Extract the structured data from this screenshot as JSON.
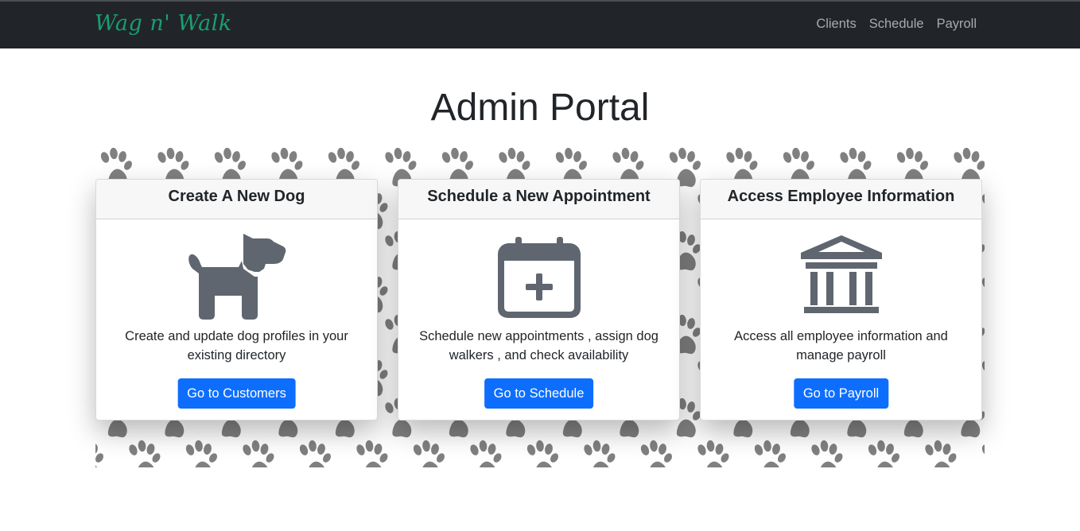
{
  "navbar": {
    "brand": "Wag n' Walk",
    "links": [
      "Clients",
      "Schedule",
      "Payroll"
    ]
  },
  "page": {
    "title": "Admin Portal"
  },
  "cards": [
    {
      "header": "Create A New Dog",
      "icon": "dog-icon",
      "text": "Create and update dog profiles in your existing directory",
      "button": "Go to Customers"
    },
    {
      "header": "Schedule a New Appointment",
      "icon": "calendar-plus-icon",
      "text": "Schedule new appointments , assign dog walkers , and check availability",
      "button": "Go to Schedule"
    },
    {
      "header": "Access Employee Information",
      "icon": "bank-building-icon",
      "text": "Access all employee information and manage payroll",
      "button": "Go to Payroll"
    }
  ],
  "colors": {
    "navbar_bg": "#212529",
    "brand": "#17a06f",
    "nav_link": "#a7abaf",
    "button": "#0d6efd",
    "icon": "#5f6670",
    "paw": "#808080"
  }
}
